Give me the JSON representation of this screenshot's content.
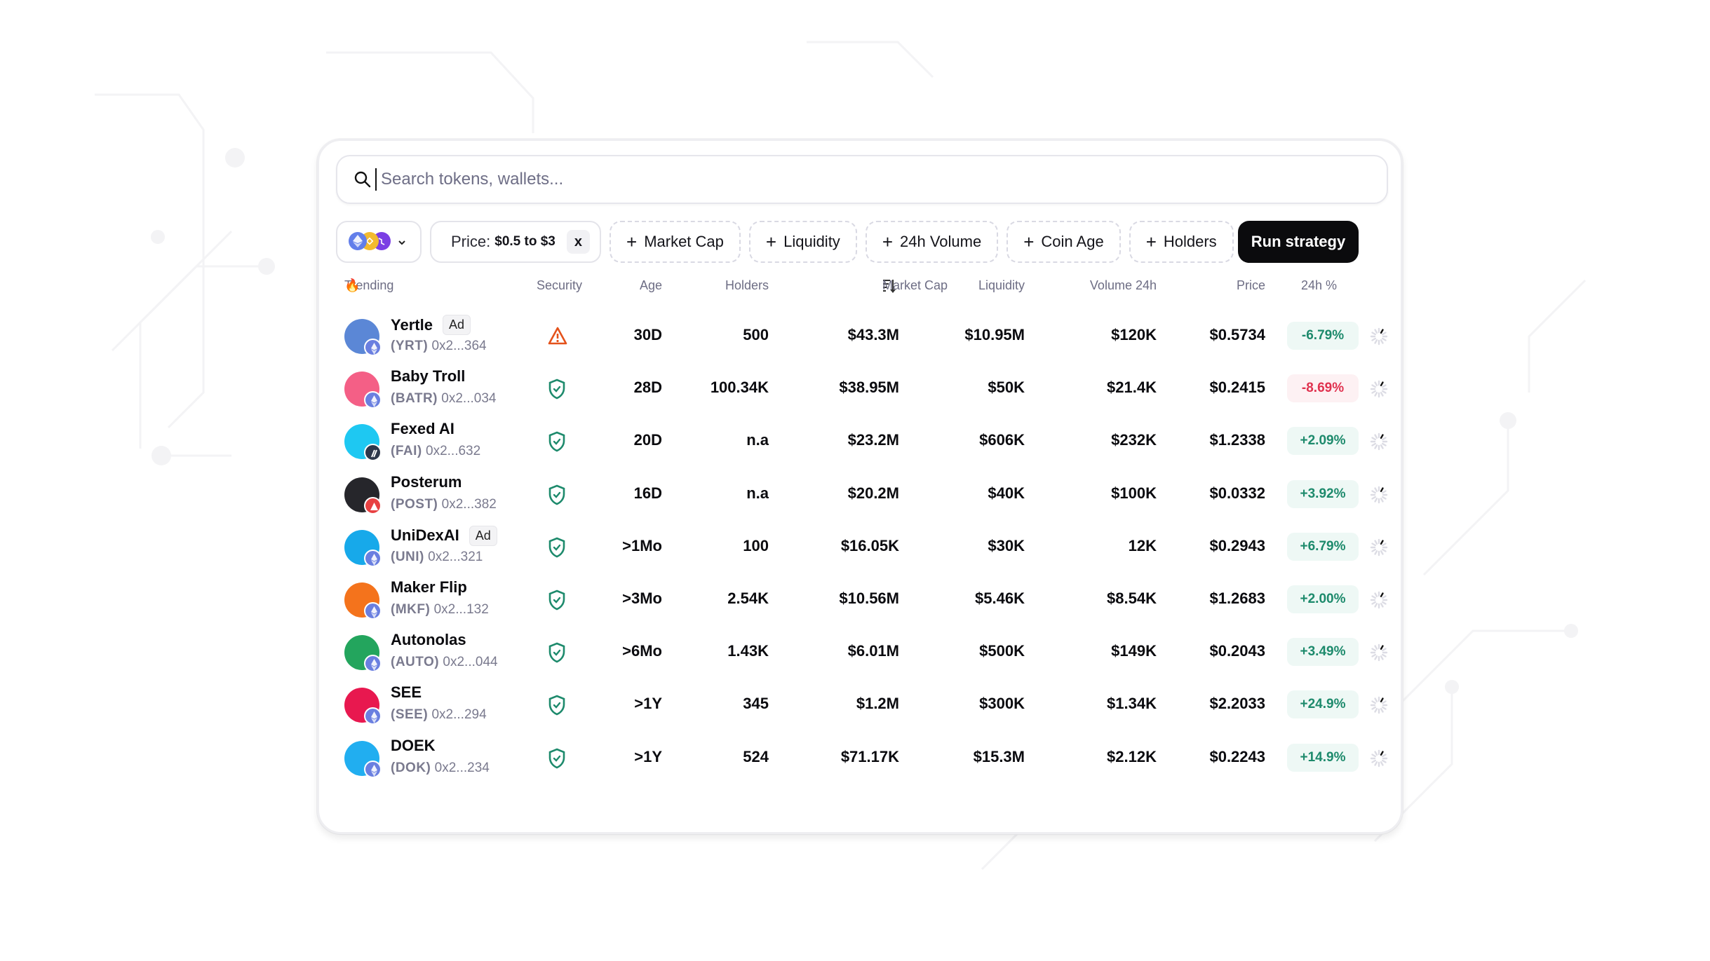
{
  "search": {
    "placeholder": "Search tokens, wallets..."
  },
  "filters": {
    "chain_selector": {
      "chains": [
        "ethereum",
        "bnb",
        "polygon"
      ]
    },
    "price_filter": {
      "label": "Price:",
      "value": "$0.5 to $3",
      "remove": "x"
    },
    "add_filters": [
      {
        "plus": "+",
        "label": "Market Cap"
      },
      {
        "plus": "+",
        "label": "Liquidity"
      },
      {
        "plus": "+",
        "label": "24h Volume"
      },
      {
        "plus": "+",
        "label": "Coin Age"
      },
      {
        "plus": "+",
        "label": "Holders"
      }
    ],
    "run_button": "Run strategy"
  },
  "table": {
    "headers": {
      "trending": "Trending",
      "trending_icon": "🔥",
      "security": "Security",
      "age": "Age",
      "holders": "Holders",
      "market_cap": "Market Cap",
      "liquidity": "Liquidity",
      "volume": "Volume 24h",
      "price": "Price",
      "change": "24h %"
    },
    "sort": {
      "column": "market_cap",
      "direction": "descending"
    },
    "rows": [
      {
        "name": "Yertle",
        "ad": "Ad",
        "symbol": "(YRT)",
        "address": "0x2...364",
        "security": "warning",
        "age": "30D",
        "holders": "500",
        "market_cap": "$43.3M",
        "liquidity": "$10.95M",
        "volume": "$120K",
        "price": "$0.5734",
        "change": "-6.79%",
        "change_style": "neg-green",
        "logo_color": "#5b87d6",
        "chain": "ethereum"
      },
      {
        "name": "Baby Troll",
        "ad": "",
        "symbol": "(BATR)",
        "address": "0x2...034",
        "security": "safe",
        "age": "28D",
        "holders": "100.34K",
        "market_cap": "$38.95M",
        "liquidity": "$50K",
        "volume": "$21.4K",
        "price": "$0.2415",
        "change": "-8.69%",
        "change_style": "neg",
        "logo_color": "#f45f86",
        "chain": "ethereum"
      },
      {
        "name": "Fexed AI",
        "ad": "",
        "symbol": "(FAI)",
        "address": "0x2...632",
        "security": "safe",
        "age": "20D",
        "holders": "n.a",
        "market_cap": "$23.2M",
        "liquidity": "$606K",
        "volume": "$232K",
        "price": "$1.2338",
        "change": "+2.09%",
        "change_style": "pos",
        "logo_color": "#1ec8f2",
        "chain": "arbitrum"
      },
      {
        "name": "Posterum",
        "ad": "",
        "symbol": "(POST)",
        "address": "0x2...382",
        "security": "safe",
        "age": "16D",
        "holders": "n.a",
        "market_cap": "$20.2M",
        "liquidity": "$40K",
        "volume": "$100K",
        "price": "$0.0332",
        "change": "+3.92%",
        "change_style": "pos",
        "logo_color": "#26262b",
        "chain": "avalanche"
      },
      {
        "name": "UniDexAI",
        "ad": "Ad",
        "symbol": "(UNI)",
        "address": "0x2...321",
        "security": "safe",
        "age": ">1Mo",
        "holders": "100",
        "market_cap": "$16.05K",
        "liquidity": "$30K",
        "volume": "12K",
        "price": "$0.2943",
        "change": "+6.79%",
        "change_style": "pos",
        "logo_color": "#17a9ea",
        "chain": "ethereum"
      },
      {
        "name": "Maker Flip",
        "ad": "",
        "symbol": "(MKF)",
        "address": "0x2...132",
        "security": "safe",
        "age": ">3Mo",
        "holders": "2.54K",
        "market_cap": "$10.56M",
        "liquidity": "$5.46K",
        "volume": "$8.54K",
        "price": "$1.2683",
        "change": "+2.00%",
        "change_style": "pos",
        "logo_color": "#f4731c",
        "chain": "ethereum"
      },
      {
        "name": "Autonolas",
        "ad": "",
        "symbol": "(AUTO)",
        "address": "0x2...044",
        "security": "safe",
        "age": ">6Mo",
        "holders": "1.43K",
        "market_cap": "$6.01M",
        "liquidity": "$500K",
        "volume": "$149K",
        "price": "$0.2043",
        "change": "+3.49%",
        "change_style": "pos",
        "logo_color": "#23a55d",
        "chain": "ethereum"
      },
      {
        "name": "SEE",
        "ad": "",
        "symbol": "(SEE)",
        "address": "0x2...294",
        "security": "safe",
        "age": ">1Y",
        "holders": "345",
        "market_cap": "$1.2M",
        "liquidity": "$300K",
        "volume": "$1.34K",
        "price": "$2.2033",
        "change": "+24.9%",
        "change_style": "pos",
        "logo_color": "#e8184f",
        "chain": "ethereum"
      },
      {
        "name": "DOEK",
        "ad": "",
        "symbol": "(DOK)",
        "address": "0x2...234",
        "security": "safe",
        "age": ">1Y",
        "holders": "524",
        "market_cap": "$71.17K",
        "liquidity": "$15.3M",
        "volume": "$2.12K",
        "price": "$0.2243",
        "change": "+14.9%",
        "change_style": "pos",
        "logo_color": "#21aef0",
        "chain": "ethereum"
      }
    ]
  },
  "colors": {
    "accent_dark": "#0b0b0d",
    "positive": "#1d8a6c",
    "negative": "#e0324f",
    "warning": "#e4521b",
    "muted_text": "#6d6d84"
  }
}
